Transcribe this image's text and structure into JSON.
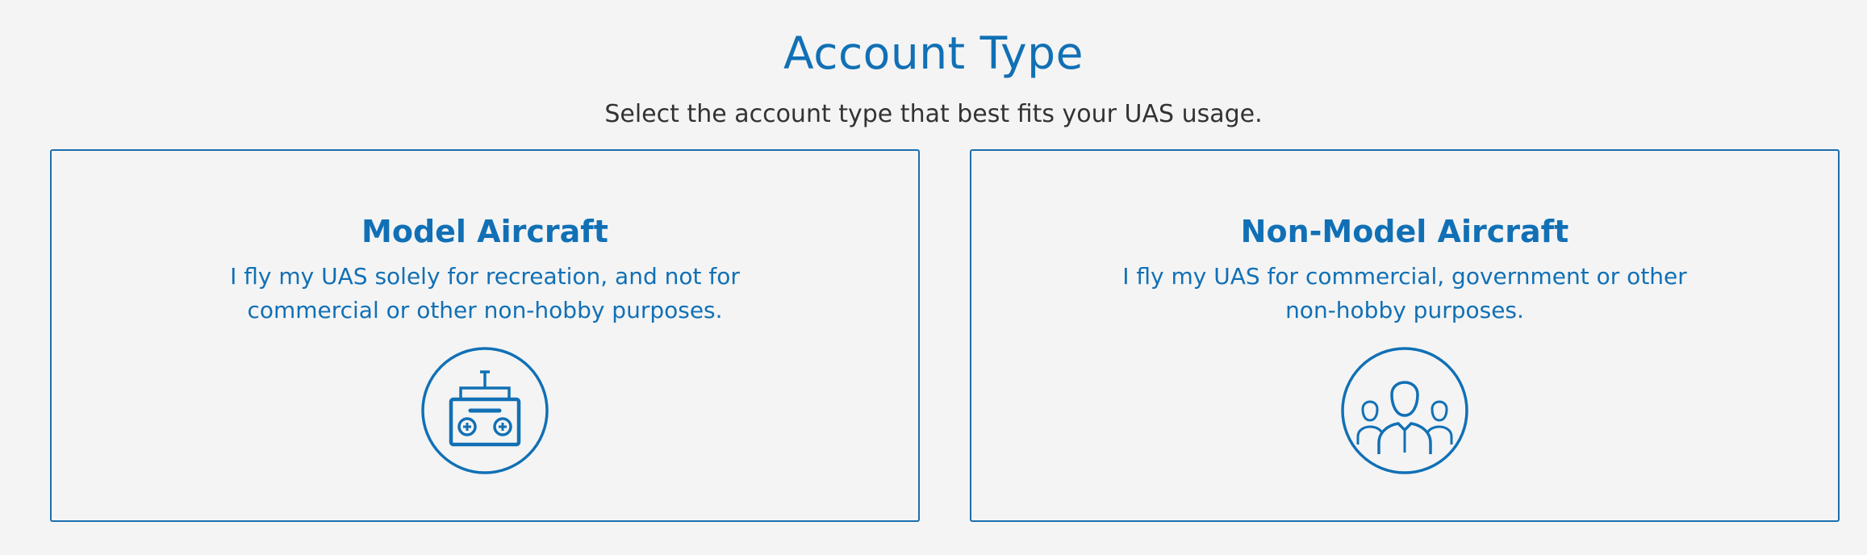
{
  "header": {
    "title": "Account Type",
    "subtitle": "Select the account type that best fits your UAS usage."
  },
  "cards": [
    {
      "title": "Model Aircraft",
      "description": "I fly my UAS solely for recreation, and not for commercial or other non-hobby purposes.",
      "icon": "remote-controller-icon"
    },
    {
      "title": "Non-Model Aircraft",
      "description": "I fly my UAS for commercial, government or other non-hobby purposes.",
      "icon": "people-group-icon"
    }
  ],
  "colors": {
    "accent": "#1170b5",
    "border": "#1b6fae",
    "background": "#f4f4f4",
    "text": "#333333"
  }
}
